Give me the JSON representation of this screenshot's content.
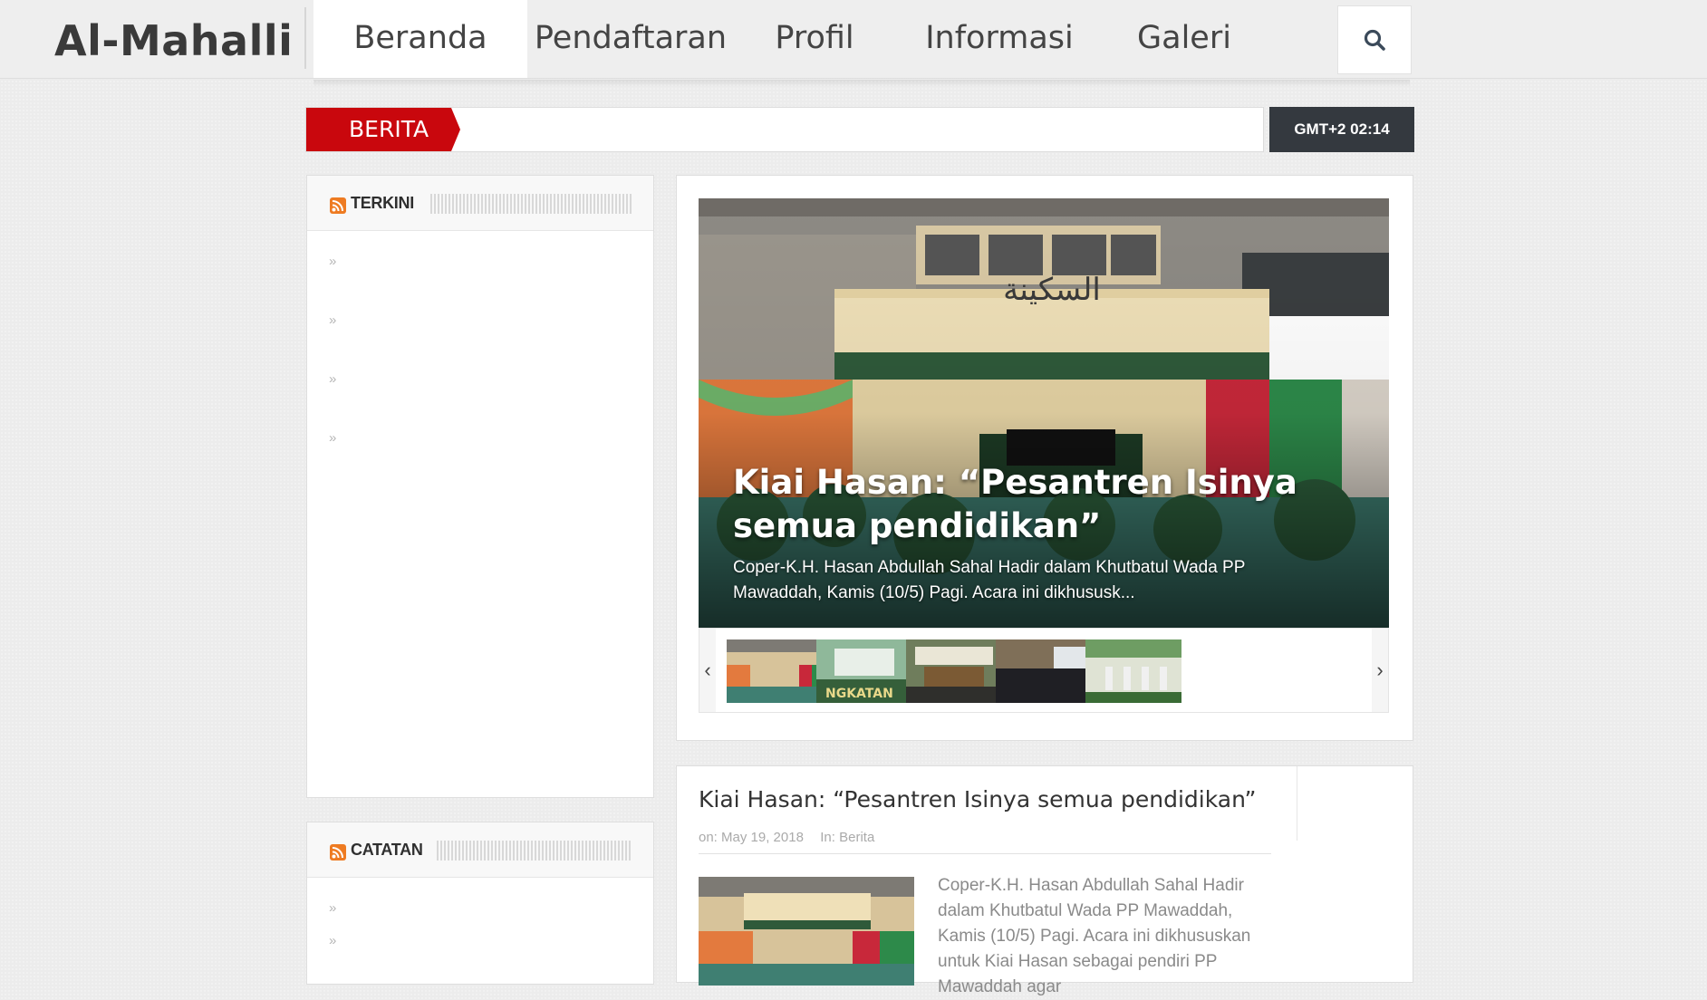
{
  "header": {
    "logo": "Al-Mahalli",
    "nav": [
      {
        "label": "Beranda",
        "active": true
      },
      {
        "label": "Pendaftaran",
        "active": false
      },
      {
        "label": "Profil",
        "active": false
      },
      {
        "label": "Informasi",
        "active": false
      },
      {
        "label": "Galeri",
        "active": false
      }
    ],
    "search_icon": "search-icon"
  },
  "breaking": {
    "label": "BERITA",
    "clock": "GMT+2 02:14"
  },
  "sidebar": {
    "terkini": {
      "title": "TERKINI",
      "icon": "rss-icon",
      "item_count": 4
    },
    "catatan": {
      "title": "CATATAN",
      "icon": "rss-icon",
      "item_count": 2
    }
  },
  "slider": {
    "title": "Kiai Hasan: “Pesantren Isinya semua pendidikan”",
    "excerpt": "Coper-K.H. Hasan Abdullah Sahal Hadir dalam Khutbatul Wada PP Mawaddah, Kamis (10/5) Pagi. Acara ini dikhususk...",
    "prev_arrow": "‹",
    "next_arrow": "›",
    "thumb_count": 5
  },
  "post": {
    "title": "Kiai Hasan: “Pesantren Isinya semua pendidikan”",
    "date": "on: May 19, 2018",
    "category": "In: Berita",
    "excerpt": "Coper-K.H. Hasan Abdullah Sahal Hadir dalam Khutbatul Wada PP Mawaddah, Kamis (10/5) Pagi. Acara ini dikhususkan untuk Kiai Hasan sebagai pendiri PP Mawaddah agar"
  },
  "colors": {
    "accent_red": "#c9070d",
    "clock_bg": "#34393f",
    "rss_orange": "#ee7b22"
  }
}
